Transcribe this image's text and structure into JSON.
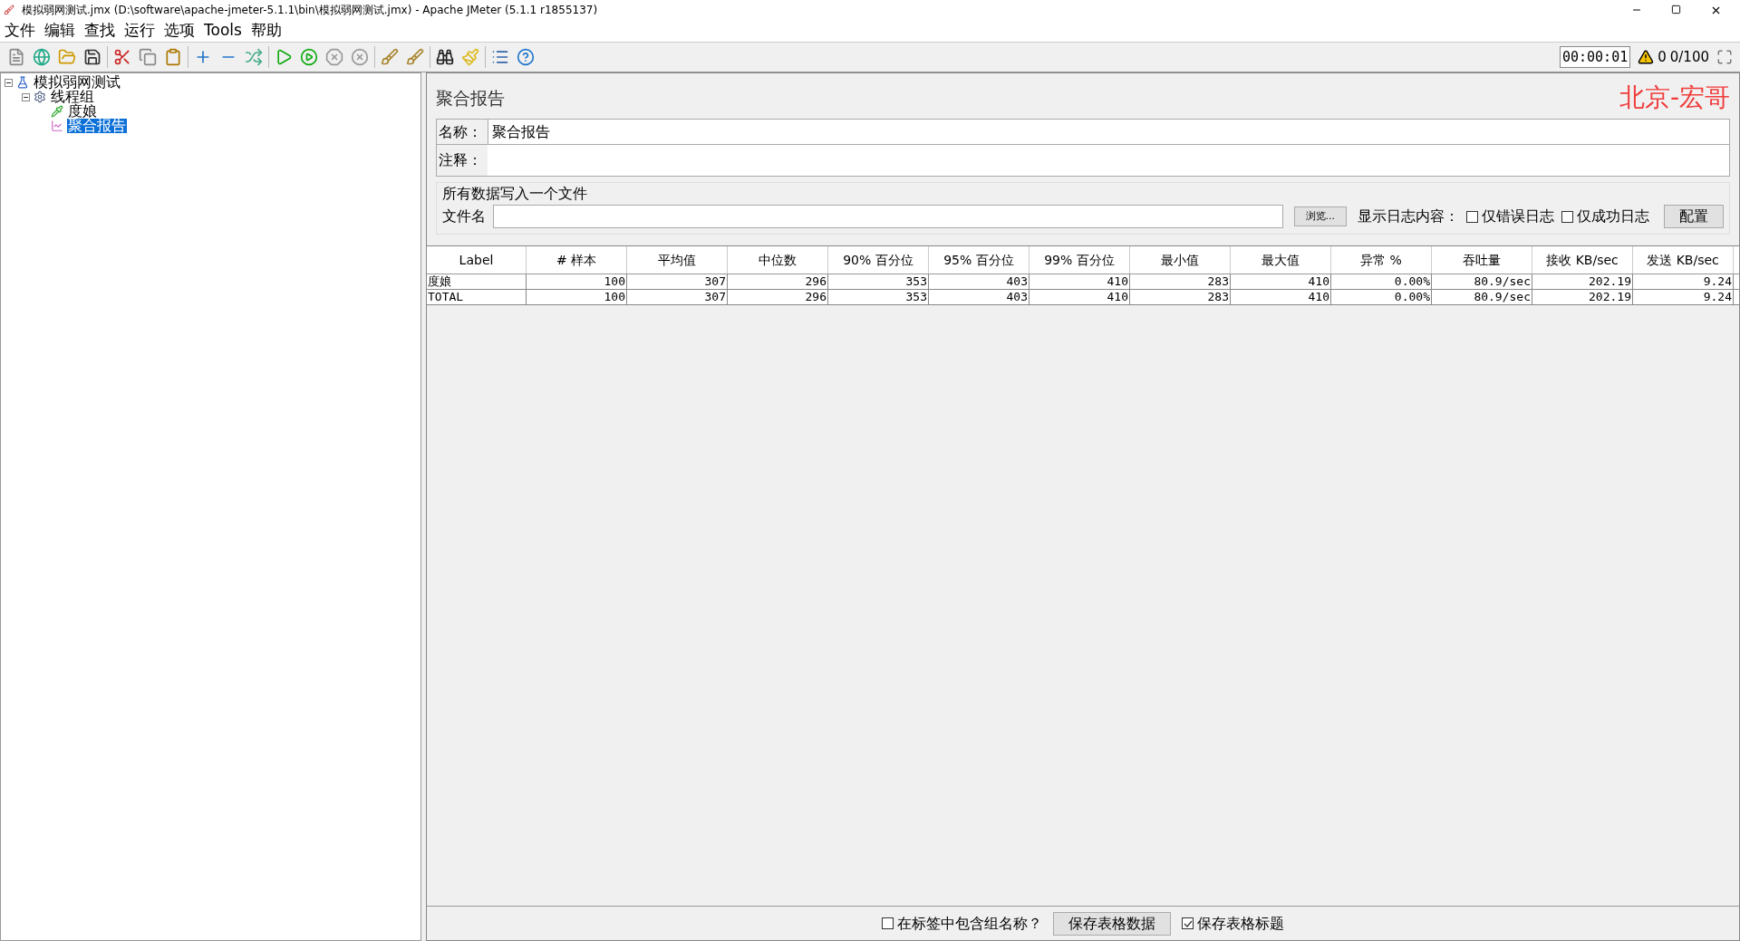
{
  "window": {
    "title": "模拟弱网测试.jmx (D:\\software\\apache-jmeter-5.1.1\\bin\\模拟弱网测试.jmx) - Apache JMeter (5.1.1 r1855137)"
  },
  "menu": [
    "文件",
    "编辑",
    "查找",
    "运行",
    "选项",
    "Tools",
    "帮助"
  ],
  "toolbar_status": {
    "timer": "00:00:01",
    "warnings": "0",
    "threads": "0/100"
  },
  "tree": [
    {
      "label": "模拟弱网测试",
      "kind": "plan",
      "selected": false,
      "expanded": true,
      "children": [
        {
          "label": "线程组",
          "kind": "group",
          "selected": false,
          "expanded": true,
          "children": [
            {
              "label": "度娘",
              "kind": "sampler",
              "selected": false
            },
            {
              "label": "聚合报告",
              "kind": "report",
              "selected": true
            }
          ]
        }
      ]
    }
  ],
  "panel": {
    "title": "聚合报告",
    "watermark_text": "北京-宏哥",
    "name_label": "名称：",
    "name_value": "聚合报告",
    "comment_label": "注释：",
    "file_section": {
      "legend": "所有数据写入一个文件",
      "file_label": "文件名",
      "browse": "浏览...",
      "log_label": "显示日志内容：",
      "errors_only": {
        "label": "仅错误日志",
        "checked": false
      },
      "success_only": {
        "label": "仅成功日志",
        "checked": false
      },
      "config": "配置"
    }
  },
  "table": {
    "columns": [
      "Label",
      "# 样本",
      "平均值",
      "中位数",
      "90% 百分位",
      "95% 百分位",
      "99% 百分位",
      "最小值",
      "最大值",
      "异常 %",
      "吞吐量",
      "接收 KB/sec",
      "发送 KB/sec"
    ],
    "rows": [
      [
        "度娘",
        "100",
        "307",
        "296",
        "353",
        "403",
        "410",
        "283",
        "410",
        "0.00%",
        "80.9/sec",
        "202.19",
        "9.24"
      ],
      [
        "TOTAL",
        "100",
        "307",
        "296",
        "353",
        "403",
        "410",
        "283",
        "410",
        "0.00%",
        "80.9/sec",
        "202.19",
        "9.24"
      ]
    ]
  },
  "footer": {
    "include_group": {
      "label": "在标签中包含组名称？",
      "checked": false
    },
    "save_data": "保存表格数据",
    "save_header": {
      "label": "保存表格标题",
      "checked": true
    }
  }
}
